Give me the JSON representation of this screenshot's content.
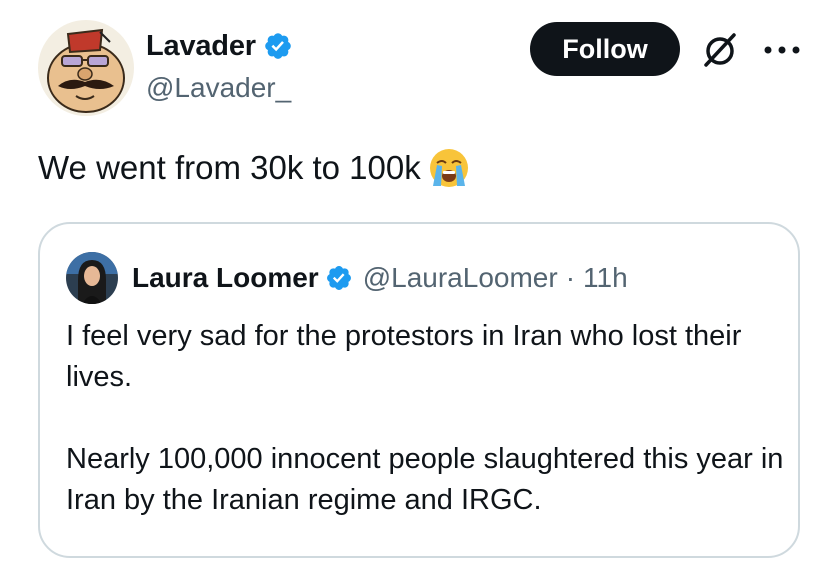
{
  "author": {
    "display_name": "Lavader",
    "handle": "@Lavader_",
    "verified_icon": "verified-badge-icon",
    "avatar_icon": "mustache-cartoon-avatar"
  },
  "actions": {
    "follow_label": "Follow",
    "grok_icon": "grok-icon",
    "more_icon": "more-options-icon"
  },
  "tweet": {
    "text": "We went from 30k to 100k",
    "emoji": "loudly-crying-face-emoji"
  },
  "quote": {
    "display_name": "Laura Loomer",
    "handle": "@LauraLoomer",
    "separator": "·",
    "time": "11h",
    "paragraph_1": "I feel very sad for the protestors in Iran who lost their lives.",
    "paragraph_2": "Nearly 100,000 innocent people slaughtered this year in Iran by the Iranian regime and IRGC."
  },
  "colors": {
    "text": "#0f1419",
    "secondary": "#536471",
    "verified_blue": "#1d9bf0",
    "border": "#cfd9de",
    "follow_bg": "#0f1419"
  }
}
